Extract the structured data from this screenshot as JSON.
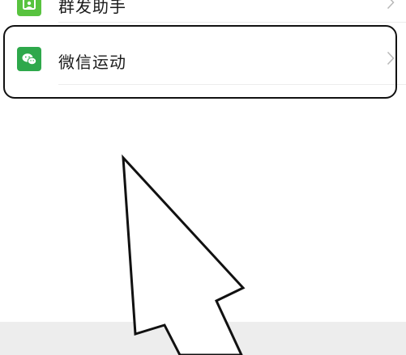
{
  "menu": {
    "items": [
      {
        "label": "群发助手",
        "icon": "broadcast-helper-icon",
        "icon_color": "#58c33f"
      },
      {
        "label": "微信运动",
        "icon": "wechat-sport-icon",
        "icon_color": "#2ea84b"
      }
    ]
  },
  "annotation": {
    "highlight_target": "微信运动",
    "highlight_color": "#111111",
    "pointer": "up-left-arrow"
  },
  "colors": {
    "background": "#ffffff",
    "bottom_band": "#ededed",
    "chevron": "#b8b8b8",
    "label": "#1a1a1a"
  }
}
